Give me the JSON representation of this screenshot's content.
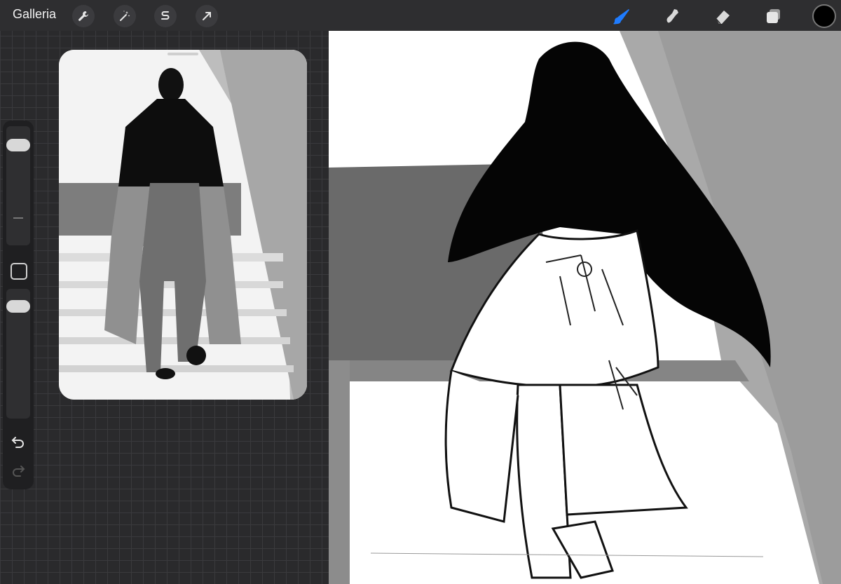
{
  "app": {
    "gallery_label": "Galleria"
  },
  "toolbar": {
    "left_tools": [
      "wrench-icon",
      "magic-wand-icon",
      "selection-s-icon",
      "transform-arrow-icon"
    ],
    "right_tools": [
      "brush-icon",
      "smudge-icon",
      "eraser-icon",
      "layers-icon"
    ],
    "active_tool": "brush-icon",
    "accent_color": "#1f7cff",
    "current_color": "#000000"
  },
  "sidebar": {
    "items": [
      "brush-size-slider",
      "modify-button",
      "brush-opacity-slider",
      "undo-icon",
      "redo-icon"
    ]
  },
  "reference": {
    "description_icon": "reference-photo"
  }
}
